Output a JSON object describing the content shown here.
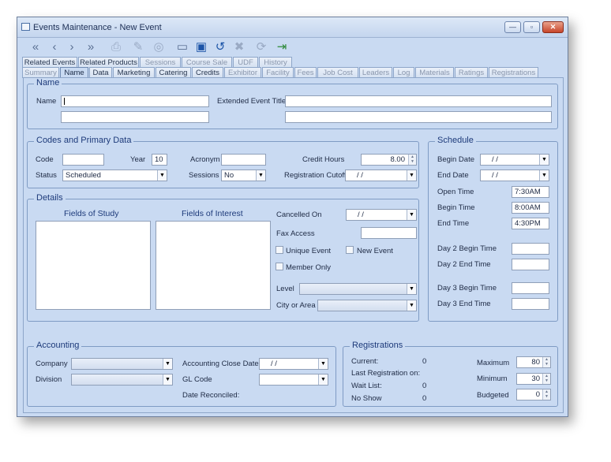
{
  "window": {
    "title": "Events Maintenance - New Event",
    "controls": {
      "minimize": "—",
      "maximize": "▫",
      "close": "✕"
    }
  },
  "toolbar": [
    {
      "name": "first-record-icon",
      "glyph": "«",
      "style": "normal"
    },
    {
      "name": "previous-record-icon",
      "glyph": "‹",
      "style": "normal"
    },
    {
      "name": "next-record-icon",
      "glyph": "›",
      "style": "normal"
    },
    {
      "name": "last-record-icon",
      "glyph": "»",
      "style": "normal"
    },
    {
      "name": "print-icon",
      "glyph": "⎙",
      "style": "dim"
    },
    {
      "name": "edit-icon",
      "glyph": "✎",
      "style": "dim"
    },
    {
      "name": "find-icon",
      "glyph": "◎",
      "style": "dim"
    },
    {
      "name": "new-document-icon",
      "glyph": "▭",
      "style": "normal"
    },
    {
      "name": "save-icon",
      "glyph": "▣",
      "style": "blue"
    },
    {
      "name": "undo-icon",
      "glyph": "↺",
      "style": "blue"
    },
    {
      "name": "delete-icon",
      "glyph": "✖",
      "style": "dim"
    },
    {
      "name": "refresh-icon",
      "glyph": "⟳",
      "style": "dim"
    },
    {
      "name": "exit-icon",
      "glyph": "⇥",
      "style": "green"
    }
  ],
  "tabs": {
    "row1": [
      "Related Events",
      "Related Products",
      "Sessions",
      "Course Sale",
      "UDF",
      "History"
    ],
    "row2": [
      "Summary",
      "Name",
      "Data",
      "Marketing",
      "Catering",
      "Credits",
      "Exhibitor",
      "Facility",
      "Fees",
      "Job Cost",
      "Leaders",
      "Log",
      "Materials",
      "Ratings",
      "Registrations"
    ],
    "active": "Name"
  },
  "name_section": {
    "title": "Name",
    "name_label": "Name",
    "name_value": "",
    "name_line2": "",
    "extended_label": "Extended Event Title",
    "extended_value": "",
    "extended_line2": ""
  },
  "codes": {
    "title": "Codes and Primary Data",
    "code_label": "Code",
    "code_value": "",
    "year_label": "Year",
    "year_value": "10",
    "acronym_label": "Acronym",
    "acronym_value": "",
    "credit_hours_label": "Credit Hours",
    "credit_hours_value": "8.00",
    "status_label": "Status",
    "status_value": "Scheduled",
    "sessions_label": "Sessions",
    "sessions_value": "No",
    "reg_cutoff_label": "Registration Cutoff",
    "reg_cutoff_value": "/    /"
  },
  "schedule": {
    "title": "Schedule",
    "begin_date_label": "Begin Date",
    "begin_date_value": "/    /",
    "end_date_label": "End Date",
    "end_date_value": "/    /",
    "open_time_label": "Open Time",
    "open_time_value": "7:30AM",
    "begin_time_label": "Begin Time",
    "begin_time_value": "8:00AM",
    "end_time_label": "End Time",
    "end_time_value": "4:30PM",
    "day2_begin_label": "Day 2 Begin Time",
    "day2_begin_value": "",
    "day2_end_label": "Day 2 End Time",
    "day2_end_value": "",
    "day3_begin_label": "Day 3 Begin Time",
    "day3_begin_value": "",
    "day3_end_label": "Day 3 End Time",
    "day3_end_value": ""
  },
  "details": {
    "title": "Details",
    "fields_of_study": "Fields of Study",
    "fields_of_interest": "Fields of Interest",
    "cancelled_on_label": "Cancelled On",
    "cancelled_on_value": "/    /",
    "fax_access_label": "Fax Access",
    "fax_access_value": "",
    "unique_event_label": "Unique Event",
    "new_event_label": "New Event",
    "member_only_label": "Member Only",
    "level_label": "Level",
    "level_value": "",
    "city_label": "City or Area",
    "city_value": ""
  },
  "accounting": {
    "title": "Accounting",
    "company_label": "Company",
    "company_value": "",
    "division_label": "Division",
    "division_value": "",
    "close_date_label": "Accounting Close Date",
    "close_date_value": "/    /",
    "gl_code_label": "GL Code",
    "gl_code_value": "",
    "date_reconciled_label": "Date Reconciled:"
  },
  "registrations": {
    "title": "Registrations",
    "current_label": "Current:",
    "current_value": "0",
    "last_reg_label": "Last Registration on:",
    "last_reg_value": "",
    "wait_list_label": "Wait List:",
    "wait_list_value": "0",
    "no_show_label": "No Show",
    "no_show_value": "0",
    "maximum_label": "Maximum",
    "maximum_value": "80",
    "minimum_label": "Minimum",
    "minimum_value": "30",
    "budgeted_label": "Budgeted",
    "budgeted_value": "0"
  }
}
